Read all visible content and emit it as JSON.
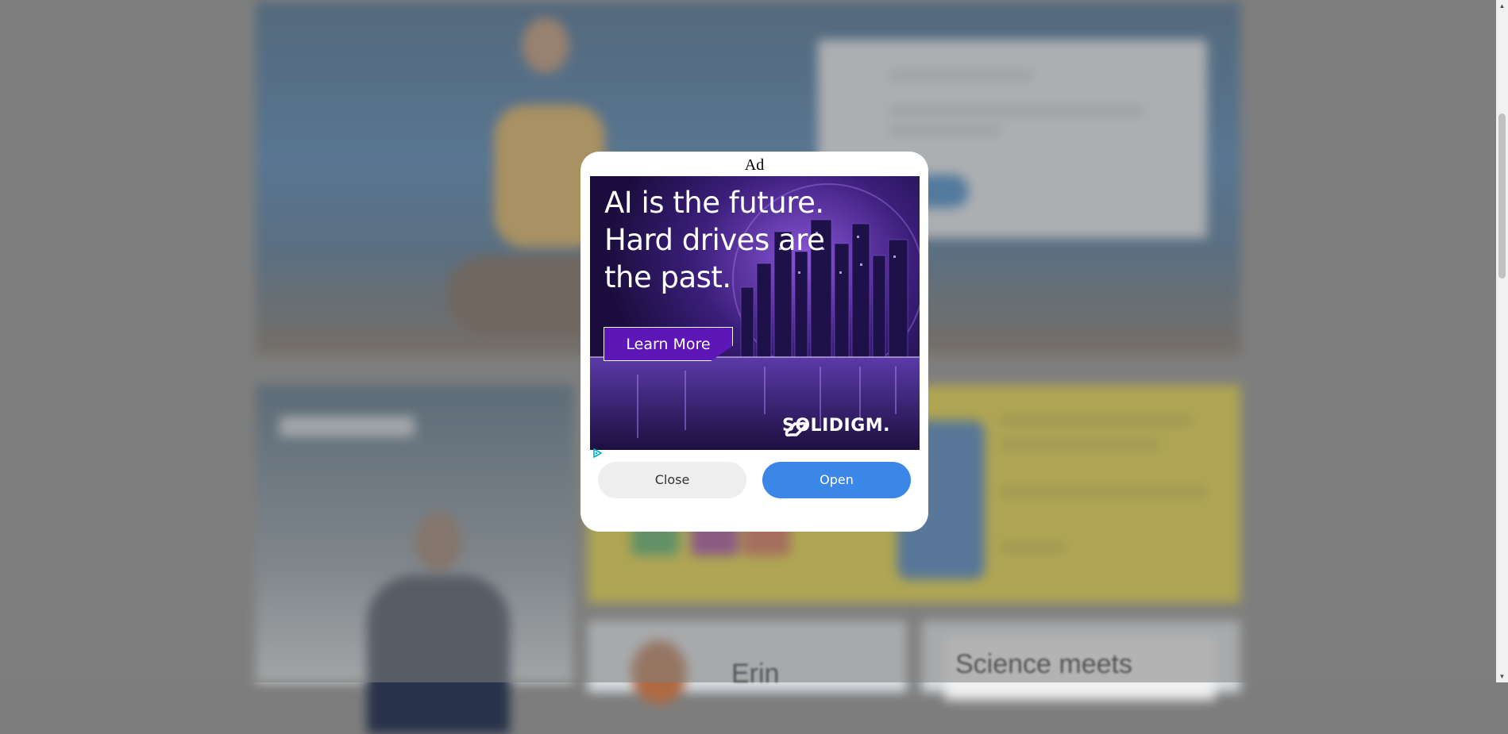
{
  "modal": {
    "title": "Ad",
    "close_label": "Close",
    "open_label": "Open"
  },
  "ad": {
    "headline_line1": "AI is the future.",
    "headline_line2": "Hard drives are",
    "headline_line3": "the past.",
    "cta_label": "Learn More",
    "brand_name": "SOLIDIGM.",
    "brand_icon": "solidigm-logo-icon",
    "adchoices_icon": "adchoices-icon",
    "colors": {
      "background": "#2a1658",
      "cta": "#5d16b8",
      "accent": "#8b4fe0"
    }
  },
  "background_page": {
    "card_a_text": "Erin",
    "card_b_text": "Science meets"
  },
  "colors": {
    "open_button": "#3b87e8",
    "close_button": "#eeeeee",
    "overlay": "#808080"
  }
}
